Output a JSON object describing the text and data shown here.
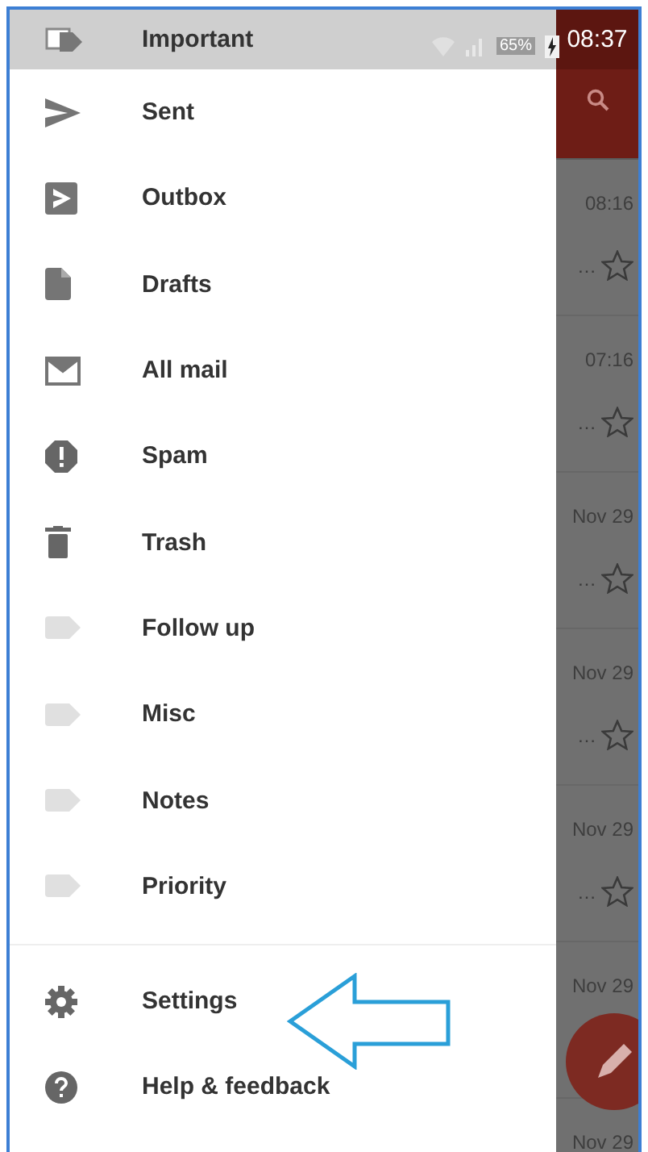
{
  "status_bar": {
    "battery": "65%",
    "time": "08:37"
  },
  "drawer": {
    "items": [
      {
        "label": "Important",
        "kind": "important"
      },
      {
        "label": "Sent",
        "kind": "sent"
      },
      {
        "label": "Outbox",
        "kind": "outbox"
      },
      {
        "label": "Drafts",
        "kind": "drafts"
      },
      {
        "label": "All mail",
        "kind": "allmail"
      },
      {
        "label": "Spam",
        "kind": "spam"
      },
      {
        "label": "Trash",
        "kind": "trash"
      },
      {
        "label": "Follow up",
        "kind": "label"
      },
      {
        "label": "Misc",
        "kind": "label"
      },
      {
        "label": "Notes",
        "kind": "label"
      },
      {
        "label": "Priority",
        "kind": "label"
      }
    ],
    "footer_items": [
      {
        "label": "Settings",
        "kind": "settings"
      },
      {
        "label": "Help & feedback",
        "kind": "help"
      }
    ]
  },
  "mail_list": {
    "rows": [
      {
        "time": "08:16",
        "snippet": "…"
      },
      {
        "time": "07:16",
        "snippet": "…"
      },
      {
        "time": "Nov 29",
        "snippet": "…"
      },
      {
        "time": "Nov 29",
        "snippet": "…"
      },
      {
        "time": "Nov 29",
        "snippet": "…"
      },
      {
        "time": "Nov 29"
      },
      {
        "time": "Nov 29"
      }
    ]
  }
}
